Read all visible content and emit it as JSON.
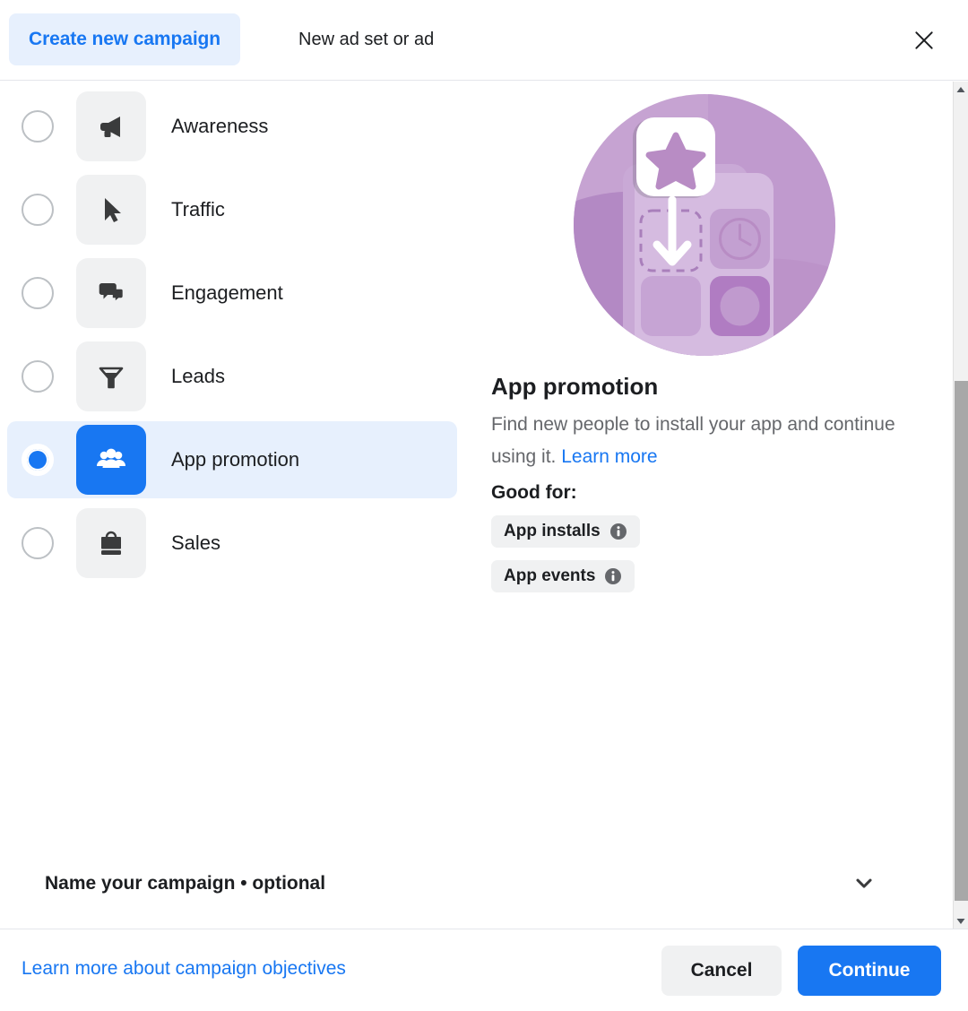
{
  "header": {
    "tab_create_label": "Create new campaign",
    "tab_newad_label": "New ad set or ad",
    "close_icon": "close-icon"
  },
  "objectives": {
    "items": [
      {
        "label": "Awareness",
        "icon": "megaphone-icon",
        "selected": false
      },
      {
        "label": "Traffic",
        "icon": "cursor-arrow-icon",
        "selected": false
      },
      {
        "label": "Engagement",
        "icon": "speech-bubbles-icon",
        "selected": false
      },
      {
        "label": "Leads",
        "icon": "funnel-icon",
        "selected": false
      },
      {
        "label": "App promotion",
        "icon": "people-group-icon",
        "selected": true
      },
      {
        "label": "Sales",
        "icon": "briefcase-icon",
        "selected": false
      }
    ]
  },
  "detail": {
    "illustration_name": "app-promotion-illustration",
    "title": "App promotion",
    "description": "Find new people to install your app and continue using it.",
    "learn_more_label": "Learn more",
    "good_for_label": "Good for:",
    "chips": [
      {
        "label": "App installs",
        "info_icon": "info-icon"
      },
      {
        "label": "App events",
        "info_icon": "info-icon"
      }
    ]
  },
  "name_campaign": {
    "label": "Name your campaign • optional",
    "chevron_icon": "chevron-down-icon"
  },
  "footer": {
    "learn_more_link": "Learn more about campaign objectives",
    "cancel_label": "Cancel",
    "continue_label": "Continue"
  },
  "colors": {
    "accent": "#1877f2",
    "selected_row_bg": "#e7f0fd",
    "tile_bg": "#f0f1f2",
    "text_secondary": "#65676b",
    "illustration_purple": "#b88cc4"
  }
}
